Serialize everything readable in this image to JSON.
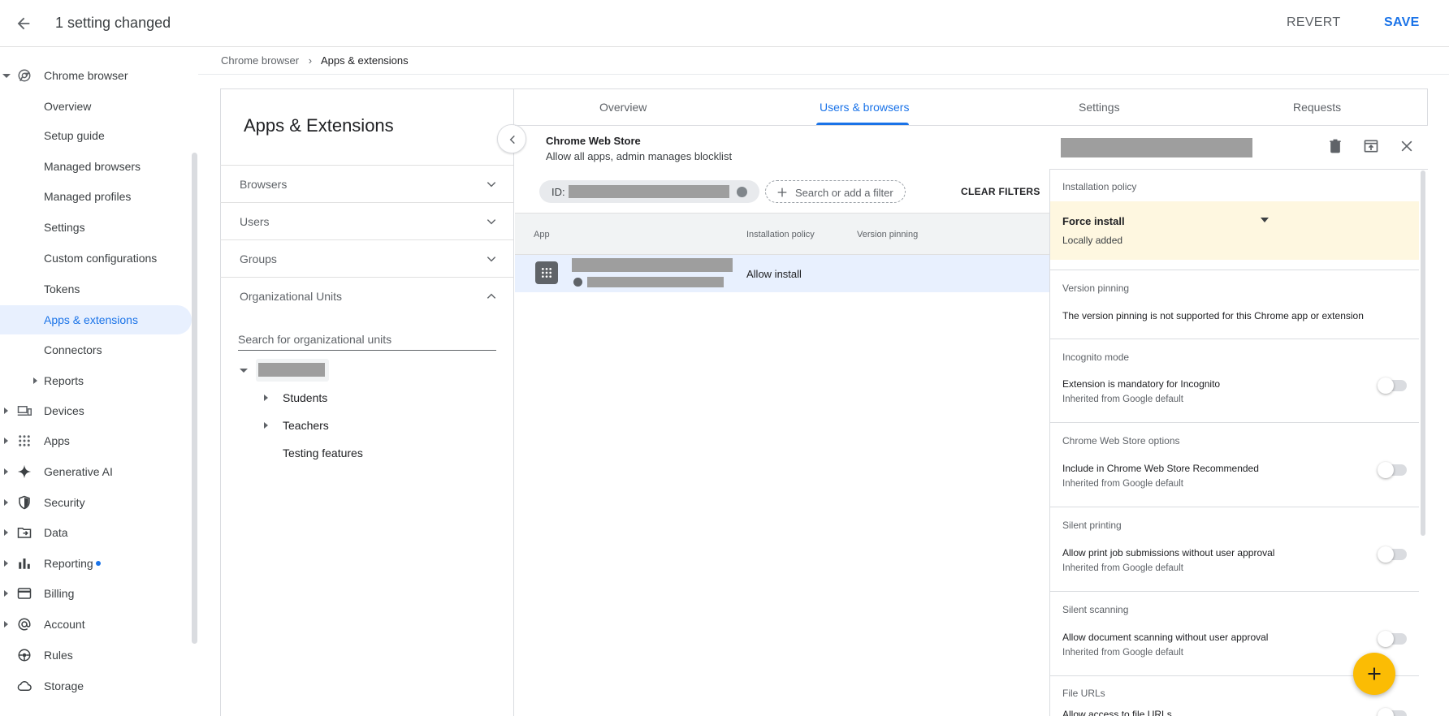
{
  "topbar": {
    "title": "1 setting changed",
    "revert": "REVERT",
    "save": "SAVE"
  },
  "sidebar": {
    "items": [
      {
        "label": "Chrome browser",
        "level": "top",
        "expanded": true,
        "icon": "chrome-icon"
      },
      {
        "label": "Overview",
        "level": "sub"
      },
      {
        "label": "Setup guide",
        "level": "sub"
      },
      {
        "label": "Managed browsers",
        "level": "sub"
      },
      {
        "label": "Managed profiles",
        "level": "sub"
      },
      {
        "label": "Settings",
        "level": "sub"
      },
      {
        "label": "Custom configurations",
        "level": "sub"
      },
      {
        "label": "Tokens",
        "level": "sub"
      },
      {
        "label": "Apps & extensions",
        "level": "sub",
        "active": true
      },
      {
        "label": "Connectors",
        "level": "sub"
      },
      {
        "label": "Reports",
        "level": "sub",
        "collapsed": true
      },
      {
        "label": "Devices",
        "level": "top",
        "icon": "devices-icon"
      },
      {
        "label": "Apps",
        "level": "top",
        "icon": "apps-grid-icon"
      },
      {
        "label": "Generative AI",
        "level": "top",
        "icon": "sparkle-icon"
      },
      {
        "label": "Security",
        "level": "top",
        "icon": "shield-icon"
      },
      {
        "label": "Data",
        "level": "top",
        "icon": "folder-icon"
      },
      {
        "label": "Reporting",
        "level": "top",
        "icon": "bar-chart-icon",
        "dot": true
      },
      {
        "label": "Billing",
        "level": "top",
        "icon": "credit-card-icon"
      },
      {
        "label": "Account",
        "level": "top",
        "icon": "at-icon"
      },
      {
        "label": "Rules",
        "level": "top",
        "icon": "rules-icon"
      },
      {
        "label": "Storage",
        "level": "top",
        "icon": "cloud-icon"
      }
    ]
  },
  "breadcrumb": {
    "parent": "Chrome browser",
    "sep": "›",
    "current": "Apps & extensions"
  },
  "left_pane": {
    "heading": "Apps & Extensions",
    "sections": [
      "Browsers",
      "Users",
      "Groups",
      "Organizational Units"
    ],
    "ou_search_placeholder": "Search for organizational units",
    "ou_children": [
      "Students",
      "Teachers",
      "Testing features"
    ]
  },
  "tabs": [
    "Overview",
    "Users & browsers",
    "Settings",
    "Requests"
  ],
  "active_tab": "Users & browsers",
  "center": {
    "store_title": "Chrome Web Store",
    "store_subtitle": "Allow all apps, admin manages blocklist",
    "id_chip_label": "ID:",
    "filter_placeholder": "Search or add a filter",
    "clear_filters": "CLEAR FILTERS",
    "columns": [
      "App",
      "Installation policy",
      "Version pinning"
    ],
    "rows": [
      {
        "policy": "Allow install"
      }
    ]
  },
  "right_panel": {
    "sections": [
      {
        "title": "Installation policy",
        "value": "Force install",
        "note": "Locally added"
      },
      {
        "title": "Version pinning",
        "main": "The version pinning is not supported for this Chrome app or extension"
      },
      {
        "title": "Incognito mode",
        "main": "Extension is mandatory for Incognito",
        "note": "Inherited from Google default"
      },
      {
        "title": "Chrome Web Store options",
        "main": "Include in Chrome Web Store Recommended",
        "note": "Inherited from Google default"
      },
      {
        "title": "Silent printing",
        "main": "Allow print job submissions without user approval",
        "note": "Inherited from Google default"
      },
      {
        "title": "Silent scanning",
        "main": "Allow document scanning without user approval",
        "note": "Inherited from Google default"
      },
      {
        "title": "File URLs",
        "main": "Allow access to file URLs"
      }
    ]
  },
  "colors": {
    "accent": "#1a73e8",
    "active_bg": "#e8f0fe",
    "highlight": "#fef7e0",
    "fab": "#fbbc04"
  }
}
